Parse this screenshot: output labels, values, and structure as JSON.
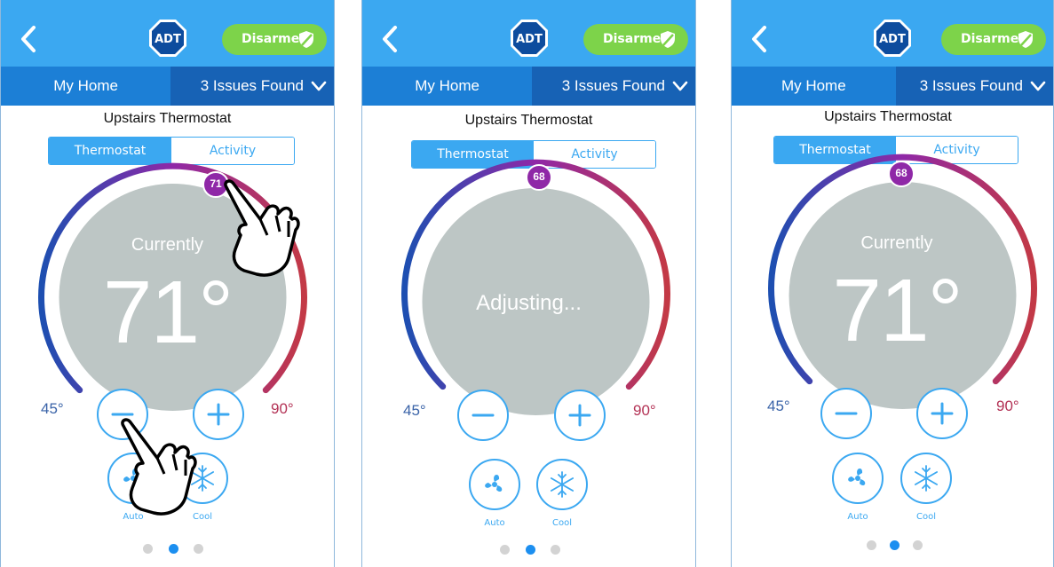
{
  "header": {
    "status_label": "Disarmed",
    "logo_text": "ADT"
  },
  "subnav": {
    "home_label": "My Home",
    "issues_label": "3 Issues Found"
  },
  "device": {
    "title": "Upstairs Thermostat"
  },
  "tabs": {
    "thermostat": "Thermostat",
    "activity": "Activity"
  },
  "range": {
    "min": "45°",
    "max": "90°"
  },
  "modes": {
    "fan_label": "Auto",
    "cool_label": "Cool"
  },
  "screens": [
    {
      "setpoint": "71",
      "center_top": "Currently",
      "center_main": "71°",
      "pager_active": 1
    },
    {
      "setpoint": "68",
      "center_main": "Adjusting...",
      "pager_active": 1
    },
    {
      "setpoint": "68",
      "center_top": "Currently",
      "center_main": "71°",
      "pager_active": 1
    }
  ],
  "colors": {
    "accent": "#3ba8f1",
    "nav": "#1c7fd6",
    "armed_status": "#7dd34a",
    "dial_face": "#bdc6c5",
    "arc_cold": "#1d4fb1",
    "arc_mid": "#8f28a7",
    "arc_hot": "#c33945"
  }
}
